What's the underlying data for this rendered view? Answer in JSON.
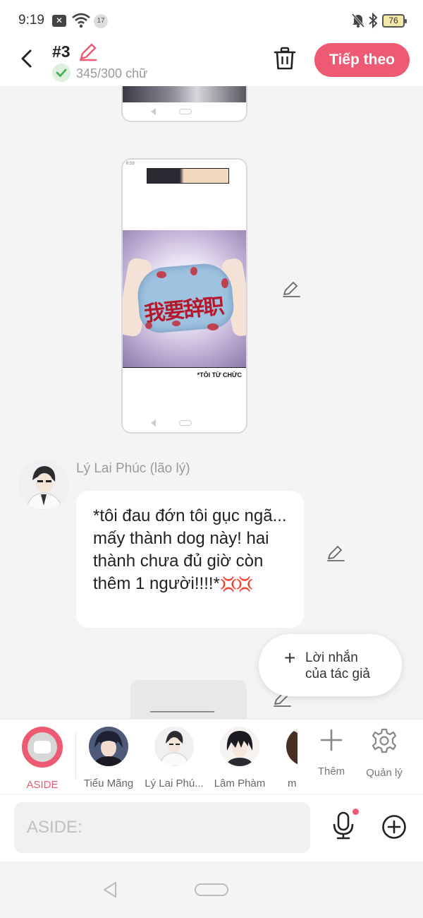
{
  "status_bar": {
    "time": "9:19",
    "notification_count": "17",
    "battery": "76"
  },
  "header": {
    "title": "#3",
    "word_count": "345/300 chữ",
    "next_label": "Tiếp theo"
  },
  "content": {
    "manga_caption": "*TÔI TỪ CHỨC",
    "mask_text": "我要辞职",
    "message": {
      "speaker": "Lý Lai Phúc (lão lý)",
      "text": "*tôi đau đớn tôi gục ngã... mấy thành dog này! hai thành chưa đủ giờ còn thêm 1 người!!!!*",
      "emoji": "💢💢"
    },
    "author_note": {
      "line1": "Lời nhắn",
      "line2": "của tác giả"
    },
    "partial_card_text": "__________"
  },
  "character_bar": {
    "items": [
      {
        "label": "ASIDE",
        "selected": true
      },
      {
        "label": "Tiểu Mãng"
      },
      {
        "label": "Lý Lai Phú..."
      },
      {
        "label": "Lâm Phàm"
      },
      {
        "label": "m"
      }
    ],
    "more_label": "Thêm",
    "manage_label": "Quản lý"
  },
  "input_bar": {
    "placeholder": "ASIDE:"
  },
  "colors": {
    "accent": "#ee5a73",
    "success": "#4cae5a",
    "background": "#f4f4f4"
  }
}
